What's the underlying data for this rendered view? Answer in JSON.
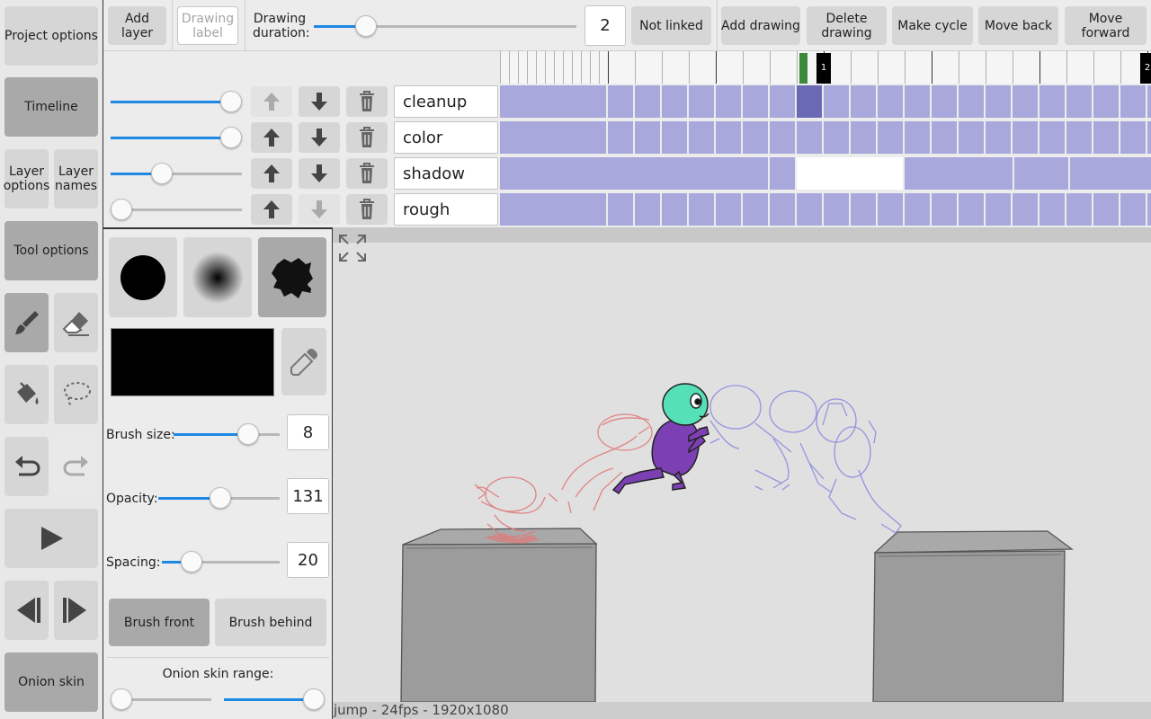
{
  "left_panel": {
    "project_options": "Project options",
    "timeline": "Timeline",
    "layer_options": "Layer options",
    "layer_names": "Layer names",
    "tool_options": "Tool options",
    "onion_skin": "Onion skin"
  },
  "toolbar": {
    "add_layer": "Add layer",
    "drawing_label": "Drawing label",
    "drawing_duration_label": "Drawing duration:",
    "drawing_duration_value": "2",
    "drawing_duration_fraction": 0.17,
    "not_linked": "Not linked",
    "add_drawing": "Add drawing",
    "delete_drawing": "Delete drawing",
    "make_cycle": "Make cycle",
    "move_back": "Move back",
    "move_forward": "Move forward"
  },
  "timeline": {
    "frame_markers": [
      "1",
      "2"
    ],
    "current_frame_color": "#3a8a3a",
    "layers": [
      {
        "name": "cleanup",
        "opacity": 1.0,
        "up_enabled": false,
        "down_enabled": true
      },
      {
        "name": "color",
        "opacity": 1.0,
        "up_enabled": true,
        "down_enabled": true
      },
      {
        "name": "shadow",
        "opacity": 0.37,
        "up_enabled": true,
        "down_enabled": true
      },
      {
        "name": "rough",
        "opacity": 0.0,
        "up_enabled": true,
        "down_enabled": false
      }
    ]
  },
  "tool_options": {
    "brush_shapes": [
      "hard-round-brush",
      "soft-round-brush",
      "textured-brush"
    ],
    "selected_brush": 2,
    "color": "#000000",
    "brush_size_label": "Brush size:",
    "brush_size_value": "8",
    "brush_size_fraction": 0.75,
    "opacity_label": "Opacity:",
    "opacity_value": "131",
    "opacity_fraction": 0.51,
    "spacing_label": "Spacing:",
    "spacing_value": "20",
    "spacing_fraction": 0.2,
    "brush_front": "Brush front",
    "brush_behind": "Brush behind",
    "onion_skin_range_label": "Onion skin range:"
  },
  "canvas": {
    "status": "jump - 24fps - 1920x1080"
  },
  "colors": {
    "accent": "#1e88e5",
    "cell": "#a8a8dc",
    "cell_selected": "#6a6ab4"
  }
}
